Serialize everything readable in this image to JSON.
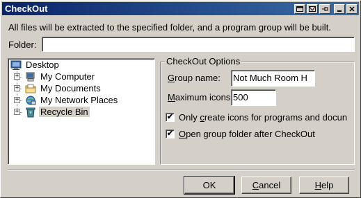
{
  "window": {
    "title": "CheckOut",
    "title_buttons": [
      "restore-icon",
      "help-icon",
      "pin-icon",
      "minimize-icon",
      "close-icon"
    ]
  },
  "intro_text": "All files will be extracted to the specified folder, and a program group will be built.",
  "folder": {
    "label": "Folder:",
    "value": ""
  },
  "tree": {
    "root": {
      "label": "Desktop",
      "icon": "desktop-icon"
    },
    "items": [
      {
        "label": "My Computer",
        "icon": "computer-icon",
        "expandable": true,
        "selected": false
      },
      {
        "label": "My Documents",
        "icon": "documents-folder-icon",
        "expandable": true,
        "selected": false
      },
      {
        "label": "My Network Places",
        "icon": "network-icon",
        "expandable": true,
        "selected": false
      },
      {
        "label": "Recycle Bin",
        "icon": "recycle-bin-icon",
        "expandable": true,
        "selected": true
      }
    ]
  },
  "options": {
    "title": "CheckOut Options",
    "group_name_label_u": "G",
    "group_name_label_rest": "roup name:",
    "group_name_value": "Not Much Room H",
    "max_icons_label_u": "M",
    "max_icons_label_rest": "aximum icons",
    "max_icons_value": "500",
    "only_icons_pre": "Only ",
    "only_icons_u": "c",
    "only_icons_post": "reate icons for programs and docun",
    "only_icons_checked": true,
    "open_folder_u": "O",
    "open_folder_rest": "pen group folder after CheckOut",
    "open_folder_checked": true
  },
  "buttons": {
    "ok": "OK",
    "cancel_u": "C",
    "cancel_rest": "ancel",
    "help_u": "H",
    "help_rest": "elp"
  },
  "check_mark": "✔",
  "colors": {
    "title_start": "#0a246a",
    "title_end": "#3a6ea5",
    "face": "#d4d0c8"
  }
}
